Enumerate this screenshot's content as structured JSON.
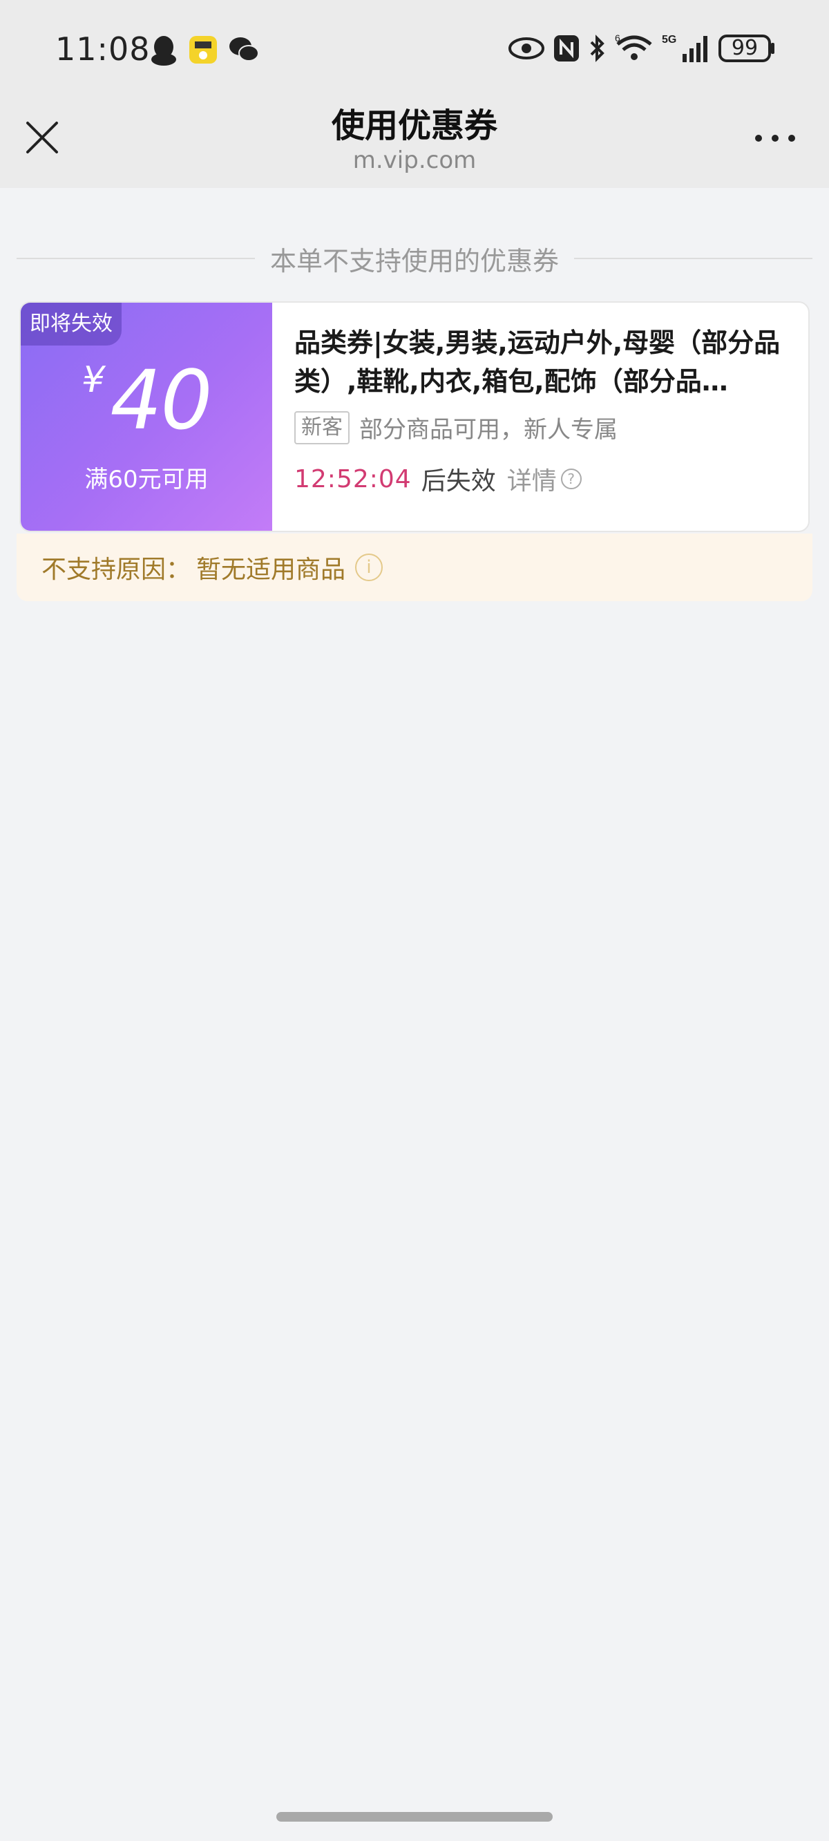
{
  "status_bar": {
    "time": "11:08",
    "network": "5G",
    "wifi_badge": "6",
    "battery": "99",
    "left_icons": [
      "qq-penguin-icon",
      "app-badge-icon",
      "wechat-icon"
    ],
    "right_icons": [
      "eye-icon",
      "nfc-icon",
      "bluetooth-icon",
      "wifi-icon",
      "signal-icon",
      "battery-icon"
    ]
  },
  "nav": {
    "title": "使用优惠券",
    "subtitle": "m.vip.com",
    "close_icon": "close-icon",
    "more_icon": "more-icon"
  },
  "section": {
    "title": "本单不支持使用的优惠券"
  },
  "coupon": {
    "badge": "即将失效",
    "currency": "¥",
    "amount": "40",
    "threshold": "满60元可用",
    "title": "品类券|女装,男装,运动户外,母婴（部分品类）,鞋靴,内衣,箱包,配饰（部分品…",
    "tag": "新客",
    "tag_desc": "部分商品可用，新人专属",
    "countdown": "12:52:04",
    "countdown_suffix": "后失效",
    "detail": "详情",
    "colors": {
      "gradient_start": "#8a6cf4",
      "gradient_end": "#c37cf7",
      "countdown": "#d23b72"
    }
  },
  "reason": {
    "label": "不支持原因：",
    "value": "暂无适用商品",
    "color": "#a07a2a"
  }
}
